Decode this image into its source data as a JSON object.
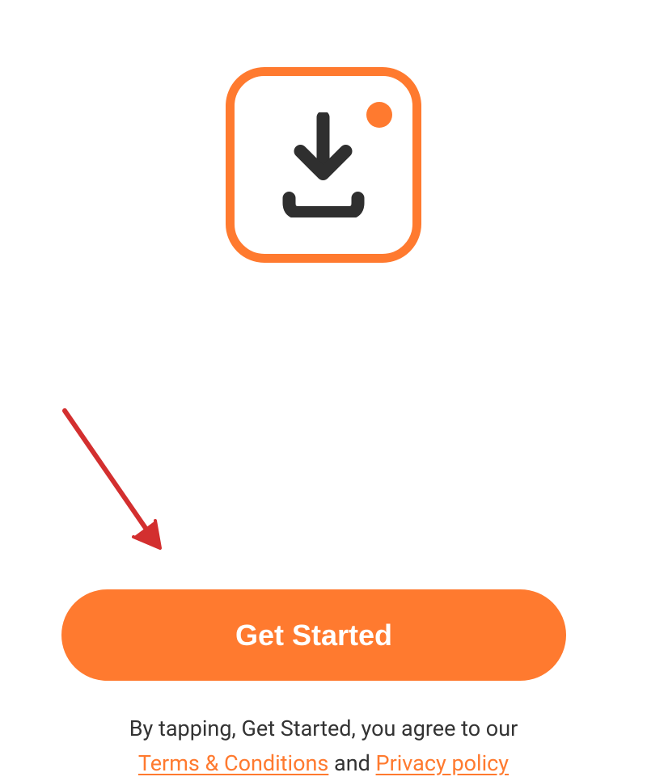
{
  "colors": {
    "accent": "#ff7a2f",
    "icon": "#2f2f2f",
    "annotation": "#d32f2f"
  },
  "logo": {
    "icon_name": "download-icon",
    "dot_name": "notification-dot"
  },
  "cta": {
    "label": "Get Started"
  },
  "footer": {
    "prefix": "By tapping, Get Started, you agree to our",
    "terms_label": "Terms & Conditions",
    "and": " and ",
    "privacy_label": "Privacy policy"
  }
}
